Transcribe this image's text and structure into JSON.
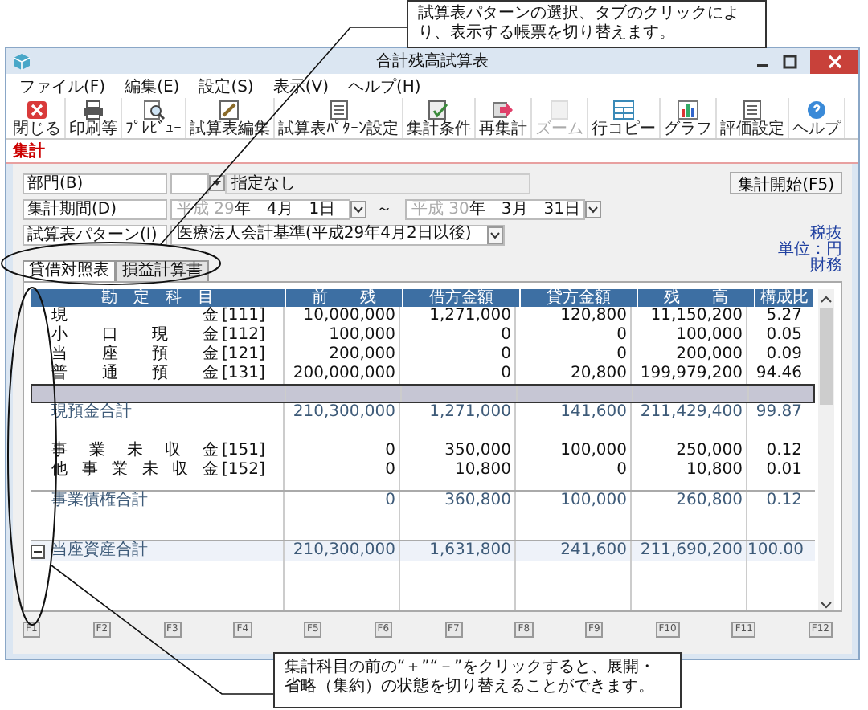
{
  "callouts": [
    {
      "text": "試算表パターンの選択、タブのクリックにより、表示する帳票を切り替えます。"
    },
    {
      "text": "集計科目の前の“＋”“－”をクリックすると、展開・省略（集約）の状態を切り替えることができます。"
    }
  ],
  "window": {
    "title": "合計残高試算表"
  },
  "menu": [
    "ファイル(F)",
    "編集(E)",
    "設定(S)",
    "表示(V)",
    "ヘルプ(H)"
  ],
  "toolbar": [
    {
      "label": "閉じる",
      "kind": "close",
      "disabled": false
    },
    {
      "label": "印刷等",
      "kind": "print",
      "disabled": false
    },
    {
      "label": "ﾌﾟﾚﾋﾞｭｰ",
      "kind": "preview",
      "disabled": false
    },
    {
      "label": "試算表編集",
      "kind": "edit",
      "disabled": false
    },
    {
      "label": "試算表ﾊﾟﾀｰﾝ設定",
      "kind": "list",
      "disabled": false
    },
    {
      "label": "集計条件",
      "kind": "check",
      "disabled": false
    },
    {
      "label": "再集計",
      "kind": "arrow",
      "disabled": false
    },
    {
      "label": "ズーム",
      "kind": "zoom",
      "disabled": true
    },
    {
      "label": "行コピー",
      "kind": "table",
      "disabled": false
    },
    {
      "label": "グラフ",
      "kind": "chart",
      "disabled": false
    },
    {
      "label": "評価設定",
      "kind": "list",
      "disabled": false
    },
    {
      "label": "ヘルプ",
      "kind": "help",
      "disabled": false
    }
  ],
  "section_tab": "集計",
  "form": {
    "department": {
      "label": "部門(B)",
      "value": "指定なし"
    },
    "period": {
      "label": "集計期間(D)",
      "separator": "～",
      "from": {
        "era": "平成",
        "year": "29",
        "rest": "年　4月　1日"
      },
      "to": {
        "era": "平成",
        "year": "30",
        "rest": "年　3月　31日"
      }
    },
    "pattern": {
      "label": "試算表パターン(I)",
      "value": "医療法人会計基準(平成29年4月2日以後)"
    },
    "start_button": "集計開始(F5)"
  },
  "notes": [
    "税抜",
    "単位：円",
    "財務"
  ],
  "report_tabs": [
    {
      "label": "貸借対照表",
      "selected": true
    },
    {
      "label": "損益計算書",
      "selected": false
    }
  ],
  "table": {
    "columns": [
      "勘　定　科　目",
      "前　　残",
      "借方金額",
      "貸方金額",
      "残　　高",
      "構成比"
    ],
    "rows": [
      {
        "kind": "account",
        "name": "現 金",
        "code": "[111]",
        "cells": [
          "10,000,000",
          "1,271,000",
          "120,800",
          "11,150,200",
          "5.27"
        ]
      },
      {
        "kind": "account",
        "name": "小 口 現 金",
        "code": "[112]",
        "cells": [
          "100,000",
          "0",
          "0",
          "100,000",
          "0.05"
        ]
      },
      {
        "kind": "account",
        "name": "当 座 預 金",
        "code": "[121]",
        "cells": [
          "200,000",
          "0",
          "0",
          "200,000",
          "0.09"
        ]
      },
      {
        "kind": "account",
        "name": "普 通 預 金",
        "code": "[131]",
        "cells": [
          "200,000,000",
          "0",
          "20,800",
          "199,979,200",
          "94.46"
        ]
      },
      {
        "kind": "separator"
      },
      {
        "kind": "total",
        "name": "現預金合計",
        "cells": [
          "210,300,000",
          "1,271,000",
          "141,600",
          "211,429,400",
          "99.87"
        ]
      },
      {
        "kind": "blank"
      },
      {
        "kind": "account",
        "name": "事 業 未 収 金",
        "code": "[151]",
        "cells": [
          "0",
          "350,000",
          "100,000",
          "250,000",
          "0.12"
        ]
      },
      {
        "kind": "account",
        "name": "他 事 業 未 収 金",
        "code": "[152]",
        "cells": [
          "0",
          "10,800",
          "0",
          "10,800",
          "0.01"
        ]
      },
      {
        "kind": "rule"
      },
      {
        "kind": "total",
        "name": "事業債権合計",
        "cells": [
          "0",
          "360,800",
          "100,000",
          "260,800",
          "0.12"
        ]
      },
      {
        "kind": "blank"
      },
      {
        "kind": "rule"
      },
      {
        "kind": "total",
        "name": "当座資産合計",
        "expanded": true,
        "highlight": true,
        "cells": [
          "210,300,000",
          "1,631,800",
          "241,600",
          "211,690,200",
          "100.00"
        ]
      }
    ]
  },
  "fkeys": [
    "F1",
    "F2",
    "F3",
    "F4",
    "F5",
    "F6",
    "F7",
    "F8",
    "F9",
    "F10",
    "F11",
    "F12"
  ]
}
